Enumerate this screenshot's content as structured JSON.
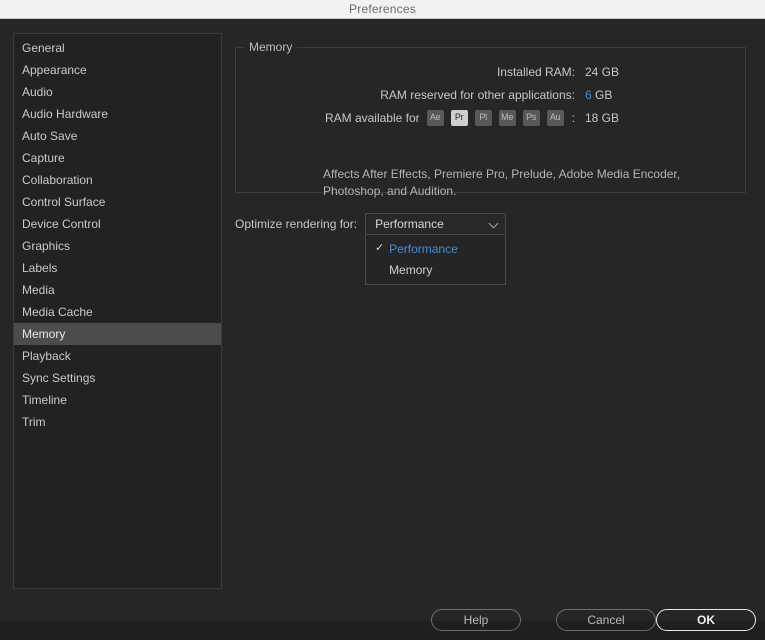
{
  "window": {
    "title": "Preferences"
  },
  "sidebar": {
    "items": [
      {
        "label": "General",
        "selected": false
      },
      {
        "label": "Appearance",
        "selected": false
      },
      {
        "label": "Audio",
        "selected": false
      },
      {
        "label": "Audio Hardware",
        "selected": false
      },
      {
        "label": "Auto Save",
        "selected": false
      },
      {
        "label": "Capture",
        "selected": false
      },
      {
        "label": "Collaboration",
        "selected": false
      },
      {
        "label": "Control Surface",
        "selected": false
      },
      {
        "label": "Device Control",
        "selected": false
      },
      {
        "label": "Graphics",
        "selected": false
      },
      {
        "label": "Labels",
        "selected": false
      },
      {
        "label": "Media",
        "selected": false
      },
      {
        "label": "Media Cache",
        "selected": false
      },
      {
        "label": "Memory",
        "selected": true
      },
      {
        "label": "Playback",
        "selected": false
      },
      {
        "label": "Sync Settings",
        "selected": false
      },
      {
        "label": "Timeline",
        "selected": false
      },
      {
        "label": "Trim",
        "selected": false
      }
    ]
  },
  "memory_group": {
    "title": "Memory",
    "installed_ram": {
      "label": "Installed RAM:",
      "value": "24 GB"
    },
    "reserved_ram": {
      "label": "RAM reserved for other applications:",
      "value": "6",
      "unit": "GB",
      "accent_color": "#3f8fd8"
    },
    "available_ram": {
      "label": "RAM available for",
      "separator": ":",
      "value": "18 GB",
      "apps": [
        {
          "abbr": "Ae",
          "name": "After Effects",
          "highlighted": false
        },
        {
          "abbr": "Pr",
          "name": "Premiere Pro",
          "highlighted": true
        },
        {
          "abbr": "Pl",
          "name": "Prelude",
          "highlighted": false
        },
        {
          "abbr": "Me",
          "name": "Adobe Media Encoder",
          "highlighted": false
        },
        {
          "abbr": "Ps",
          "name": "Photoshop",
          "highlighted": false
        },
        {
          "abbr": "Au",
          "name": "Audition",
          "highlighted": false
        }
      ]
    },
    "affects_note": "Affects After Effects, Premiere Pro, Prelude, Adobe Media Encoder, Photoshop, and Audition."
  },
  "optimize": {
    "label": "Optimize rendering for:",
    "selected_value": "Performance",
    "dropdown_open": true,
    "options": [
      {
        "label": "Performance",
        "checked": true,
        "check_glyph": "✓"
      },
      {
        "label": "Memory",
        "checked": false,
        "check_glyph": ""
      }
    ]
  },
  "footer": {
    "help_label": "Help",
    "cancel_label": "Cancel",
    "ok_label": "OK"
  }
}
